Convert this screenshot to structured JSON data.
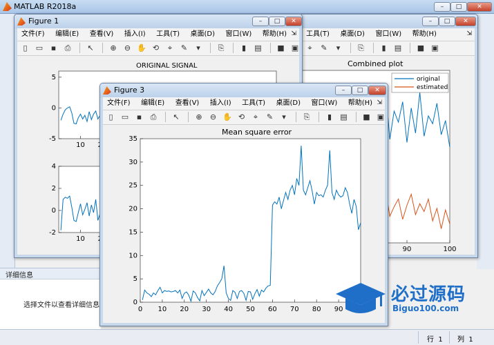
{
  "app": {
    "title": "MATLAB R2018a"
  },
  "detail_panel": {
    "header": "详细信息",
    "message": "选择文件以查看详细信息"
  },
  "statusbar": {
    "row_label": "行",
    "row_value": "1",
    "col_label": "列",
    "col_value": "1"
  },
  "window_controls": {
    "minimize": "–",
    "maximize": "□",
    "close": "✕"
  },
  "menu": [
    "文件(F)",
    "编辑(E)",
    "查看(V)",
    "插入(I)",
    "工具(T)",
    "桌面(D)",
    "窗口(W)",
    "帮助(H)"
  ],
  "toolbar_icons": [
    "new-file-icon",
    "open-folder-icon",
    "save-icon",
    "print-icon",
    "pointer-icon",
    "zoom-in-icon",
    "zoom-out-icon",
    "pan-hand-icon",
    "rotate-icon",
    "data-cursor-icon",
    "brush-icon",
    "link-icon",
    "colorbar-icon",
    "legend-icon",
    "hide-tools-icon",
    "dock-icon"
  ],
  "figures": {
    "figure1": {
      "title": "Figure 1"
    },
    "figure2": {
      "title": ""
    },
    "figure3": {
      "title": "Figure 3"
    }
  },
  "chart_data": [
    {
      "id": "figure1-top",
      "type": "line",
      "title": "ORIGINAL SIGNAL",
      "xlim": [
        0,
        100
      ],
      "ylim": [
        -5,
        6
      ],
      "yticks": [
        -5,
        0,
        5
      ],
      "xticks_visible": [
        "10",
        "20"
      ],
      "series": [
        {
          "color": "#0072bd",
          "x": [
            1,
            2,
            3,
            4,
            5,
            6,
            7,
            8,
            9,
            10,
            11,
            12,
            13,
            14,
            15,
            16,
            17,
            18,
            19,
            20,
            21,
            22,
            23
          ],
          "values": [
            -2.0,
            -1.0,
            -0.3,
            0.0,
            0.2,
            -0.8,
            -2.5,
            -2.6,
            -1.6,
            -1.0,
            -1.8,
            -1.2,
            -2.2,
            -0.6,
            -1.9,
            -1.0,
            -0.5,
            -1.8,
            -1.2,
            0.2,
            -1.6,
            -0.4,
            0.6
          ]
        }
      ]
    },
    {
      "id": "figure1-bottom",
      "type": "line",
      "title": "",
      "xlim": [
        0,
        100
      ],
      "ylim": [
        -2,
        4
      ],
      "yticks": [
        -2,
        0,
        2,
        4
      ],
      "xticks_visible": [
        "10",
        "20"
      ],
      "series": [
        {
          "color": "#0072bd",
          "x": [
            1,
            2,
            3,
            4,
            5,
            6,
            7,
            8,
            9,
            10,
            11,
            12,
            13,
            14,
            15,
            16,
            17,
            18,
            19,
            20,
            21,
            22,
            23
          ],
          "values": [
            -1.8,
            1.0,
            1.2,
            1.1,
            1.3,
            0.3,
            -0.9,
            -1.0,
            -0.2,
            0.6,
            -0.4,
            0.1,
            0.7,
            -0.5,
            0.5,
            -0.2,
            1.0,
            -0.9,
            -0.3,
            1.2,
            -0.6,
            0.9,
            1.2
          ]
        }
      ]
    },
    {
      "id": "figure2-combined",
      "type": "line",
      "title": "Combined plot",
      "xlim": [
        0,
        100
      ],
      "ylim": [
        -3,
        8
      ],
      "xticks": [
        80,
        90,
        100
      ],
      "legend": {
        "placement": "top-right",
        "entries": [
          "original",
          "estimated"
        ]
      },
      "series": [
        {
          "name": "original",
          "color": "#0072bd",
          "x": [
            71,
            72,
            73,
            74,
            75,
            76,
            77,
            78,
            79,
            80,
            81,
            82,
            83,
            84,
            85,
            86,
            87,
            88,
            89,
            90,
            91,
            92,
            93,
            94,
            95,
            96,
            97,
            98,
            99,
            100
          ],
          "values": [
            5.3,
            4.0,
            6.2,
            3.6,
            5.6,
            4.1,
            6.8,
            3.2,
            5.0,
            4.4,
            6.4,
            3.0,
            5.8,
            4.3,
            6.9,
            3.6,
            5.4,
            4.7,
            6.0,
            3.4,
            5.6,
            4.0,
            6.6,
            3.8,
            5.1,
            4.6,
            5.9,
            3.9,
            4.8,
            3.1
          ]
        },
        {
          "name": "estimated",
          "color": "#d95319",
          "x": [
            71,
            72,
            73,
            74,
            75,
            76,
            77,
            78,
            79,
            80,
            81,
            82,
            83,
            84,
            85,
            86,
            87,
            88,
            89,
            90,
            91,
            92,
            93,
            94,
            95,
            96,
            97,
            98,
            99,
            100
          ],
          "values": [
            -0.2,
            -1.0,
            0.2,
            -1.2,
            -0.6,
            -0.9,
            0.3,
            -1.4,
            -0.5,
            -0.8,
            -0.1,
            -1.7,
            -0.4,
            -1.1,
            0.4,
            -1.3,
            -0.7,
            -0.2,
            -1.5,
            -0.6,
            0.1,
            -1.2,
            -0.5,
            -1.0,
            -0.2,
            -1.6,
            -0.8,
            -2.1,
            -0.9,
            -1.8
          ]
        }
      ]
    },
    {
      "id": "figure3-mse",
      "type": "line",
      "title": "Mean square error",
      "xlim": [
        0,
        100
      ],
      "ylim": [
        0,
        35
      ],
      "xticks": [
        0,
        10,
        20,
        30,
        40,
        50,
        60,
        70,
        80,
        90
      ],
      "yticks": [
        0,
        5,
        10,
        15,
        20,
        25,
        30,
        35
      ],
      "series": [
        {
          "color": "#0072bd",
          "x": [
            1,
            2,
            3,
            4,
            5,
            6,
            7,
            8,
            9,
            10,
            11,
            12,
            13,
            14,
            15,
            16,
            17,
            18,
            19,
            20,
            21,
            22,
            23,
            24,
            25,
            26,
            27,
            28,
            29,
            30,
            31,
            32,
            33,
            34,
            35,
            36,
            37,
            38,
            39,
            40,
            41,
            42,
            43,
            44,
            45,
            46,
            47,
            48,
            49,
            50,
            51,
            52,
            53,
            54,
            55,
            56,
            57,
            58,
            59,
            60,
            61,
            62,
            63,
            64,
            65,
            66,
            67,
            68,
            69,
            70,
            71,
            72,
            73,
            74,
            75,
            76,
            77,
            78,
            79,
            80,
            81,
            82,
            83,
            84,
            85,
            86,
            87,
            88,
            89,
            90,
            91,
            92,
            93,
            94,
            95,
            96,
            97,
            98,
            99,
            100
          ],
          "values": [
            0.5,
            2.6,
            2.0,
            1.7,
            1.2,
            2.0,
            1.6,
            2.5,
            3.2,
            2.0,
            2.5,
            2.3,
            2.4,
            2.2,
            2.3,
            2.5,
            2.0,
            2.6,
            0.8,
            1.9,
            2.2,
            1.5,
            0.2,
            2.4,
            2.0,
            1.0,
            0.3,
            2.5,
            1.4,
            2.1,
            2.8,
            2.0,
            1.6,
            2.3,
            3.5,
            4.2,
            5.0,
            7.8,
            2.0,
            0.8,
            0.4,
            2.5,
            2.1,
            0.8,
            2.3,
            2.5,
            1.9,
            0.4,
            2.3,
            2.2,
            0.6,
            1.8,
            2.7,
            1.3,
            2.6,
            2.2,
            3.0,
            3.5,
            3.6,
            20.8,
            21.5,
            21.0,
            22.5,
            20.0,
            21.8,
            23.5,
            22.0,
            24.0,
            25.0,
            23.0,
            26.5,
            25.0,
            33.5,
            24.0,
            23.0,
            24.5,
            26.0,
            23.8,
            21.0,
            23.5,
            22.8,
            23.0,
            22.5,
            24.0,
            25.0,
            32.5,
            23.5,
            22.0,
            24.0,
            23.0,
            22.5,
            22.8,
            24.5,
            23.5,
            21.0,
            19.0,
            22.0,
            20.5,
            15.5,
            17.0
          ]
        }
      ]
    }
  ],
  "watermark": {
    "text": "必过源码",
    "url": "Biguo100.com"
  }
}
